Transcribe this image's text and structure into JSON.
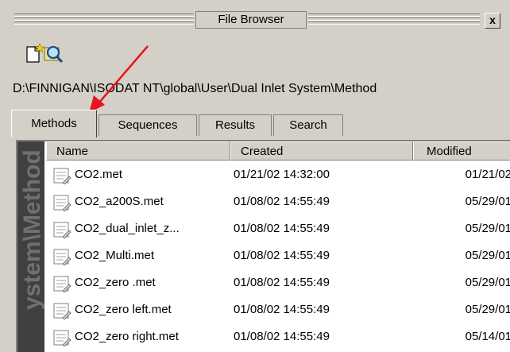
{
  "window": {
    "title": "File Browser",
    "close_label": "x"
  },
  "toolbar": {
    "new_icon": "new-file-icon",
    "search_icon": "search-icon"
  },
  "path": "D:\\FINNIGAN\\ISODAT NT\\global\\User\\Dual Inlet System\\Method",
  "tabs": [
    {
      "label": "Methods",
      "active": true
    },
    {
      "label": "Sequences",
      "active": false
    },
    {
      "label": "Results",
      "active": false
    },
    {
      "label": "Search",
      "active": false
    }
  ],
  "side_label": "ystem\\Method",
  "table": {
    "headers": [
      "Name",
      "Created",
      "Modified"
    ],
    "rows": [
      {
        "name": "CO2.met",
        "created": "01/21/02 14:32:00",
        "modified": "01/21/02"
      },
      {
        "name": "CO2_a200S.met",
        "created": "01/08/02 14:55:49",
        "modified": "05/29/01"
      },
      {
        "name": "CO2_dual_inlet_z...",
        "created": "01/08/02 14:55:49",
        "modified": "05/29/01"
      },
      {
        "name": "CO2_Multi.met",
        "created": "01/08/02 14:55:49",
        "modified": "05/29/01"
      },
      {
        "name": "CO2_zero .met",
        "created": "01/08/02 14:55:49",
        "modified": "05/29/01"
      },
      {
        "name": "CO2_zero left.met",
        "created": "01/08/02 14:55:49",
        "modified": "05/29/01"
      },
      {
        "name": "CO2_zero right.met",
        "created": "01/08/02 14:55:49",
        "modified": "05/14/01"
      }
    ]
  },
  "colors": {
    "annotation_arrow": "#e8141e",
    "side_bar": "#404040",
    "chrome": "#d4d0c8"
  }
}
